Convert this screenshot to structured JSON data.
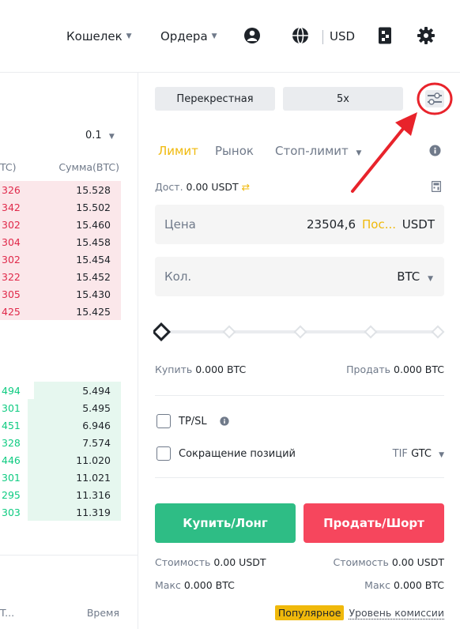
{
  "header": {
    "wallet": "Кошелек",
    "orders": "Ордера",
    "currency": "USD"
  },
  "orderbook": {
    "precision": "0.1",
    "col_price": "TC)",
    "col_sum": "Сумма(BTC)",
    "asks": [
      {
        "p": "326",
        "s": "15.528"
      },
      {
        "p": "342",
        "s": "15.502"
      },
      {
        "p": "302",
        "s": "15.460"
      },
      {
        "p": "304",
        "s": "15.458"
      },
      {
        "p": "302",
        "s": "15.454"
      },
      {
        "p": "322",
        "s": "15.452"
      },
      {
        "p": "305",
        "s": "15.430"
      },
      {
        "p": "425",
        "s": "15.425"
      }
    ],
    "bids": [
      {
        "p": "494",
        "s": "5.494"
      },
      {
        "p": "301",
        "s": "5.495"
      },
      {
        "p": "451",
        "s": "6.946"
      },
      {
        "p": "328",
        "s": "7.574"
      },
      {
        "p": "446",
        "s": "11.020"
      },
      {
        "p": "301",
        "s": "11.021"
      },
      {
        "p": "295",
        "s": "11.316"
      },
      {
        "p": "303",
        "s": "11.319"
      }
    ],
    "trades_col": "T...",
    "time_col": "Время"
  },
  "panel": {
    "margin_mode": "Перекрестная",
    "leverage": "5x",
    "tabs": {
      "limit": "Лимит",
      "market": "Рынок",
      "stop": "Стоп-лимит"
    },
    "available_label": "Дост.",
    "available_value": "0.00 USDT",
    "price_label": "Цена",
    "price_value": "23504,6",
    "price_last": "Пос...",
    "price_unit": "USDT",
    "qty_label": "Кол.",
    "qty_unit": "BTC",
    "buy_label": "Купить",
    "buy_value": "0.000 BTC",
    "sell_label": "Продать",
    "sell_value": "0.000 BTC",
    "tpsl": "TP/SL",
    "reduce": "Сокращение позиций",
    "tif_label": "TIF",
    "tif_value": "GTC",
    "buy_button": "Купить/Лонг",
    "sell_button": "Продать/Шорт",
    "cost_label": "Стоимость",
    "cost_buy": "0.00 USDT",
    "cost_sell": "0.00 USDT",
    "max_label": "Макс",
    "max_buy": "0.000 BTC",
    "max_sell": "0.000 BTC",
    "popular": "Популярное",
    "fee_link": "Уровень комиссии"
  },
  "colors": {
    "ask": "#e0294a",
    "bid": "#0ecb81",
    "accent": "#f0b90b",
    "annotation": "#e8232b"
  }
}
